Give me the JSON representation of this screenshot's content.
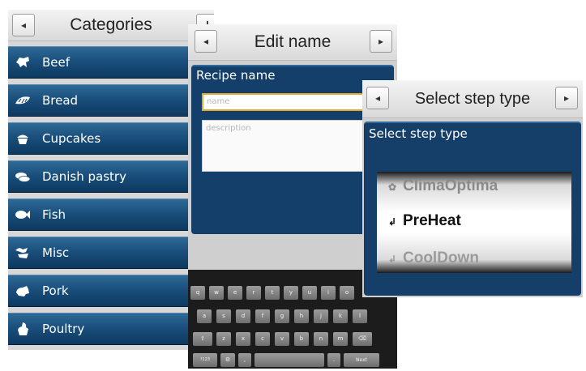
{
  "categories_screen": {
    "title": "Categories",
    "nav_left": "◂",
    "nav_right": "+",
    "items": [
      {
        "label": "Beef",
        "icon": "cow-icon"
      },
      {
        "label": "Bread",
        "icon": "bread-icon"
      },
      {
        "label": "Cupcakes",
        "icon": "cupcake-icon"
      },
      {
        "label": "Danish pastry",
        "icon": "pastry-icon"
      },
      {
        "label": "Fish",
        "icon": "fish-icon"
      },
      {
        "label": "Misc",
        "icon": "misc-icon"
      },
      {
        "label": "Pork",
        "icon": "pig-icon"
      },
      {
        "label": "Poultry",
        "icon": "chicken-icon"
      }
    ]
  },
  "edit_screen": {
    "title": "Edit name",
    "nav_left": "◂",
    "nav_right": "▸",
    "panel_title": "Recipe name",
    "name_placeholder": "name",
    "description_placeholder": "description",
    "keyboard": {
      "row1": [
        "q",
        "w",
        "e",
        "r",
        "t",
        "y",
        "u",
        "i",
        "o"
      ],
      "row2": [
        "a",
        "s",
        "d",
        "f",
        "g",
        "h",
        "j",
        "k",
        "l"
      ],
      "row3": [
        "⇧",
        "z",
        "x",
        "c",
        "v",
        "b",
        "n",
        "m",
        "⌫"
      ],
      "row4": [
        "?123",
        "⚙",
        ",",
        "",
        ".",
        "Next"
      ]
    }
  },
  "step_screen": {
    "title": "Select step type",
    "nav_left": "◂",
    "nav_right": "▸",
    "panel_title": "Select step type",
    "options": [
      {
        "label": "ClimaOptima",
        "selected": false
      },
      {
        "label": "PreHeat",
        "selected": true
      },
      {
        "label": "CoolDown",
        "selected": false
      }
    ]
  },
  "colors": {
    "row_blue": "#1a4f7c",
    "panel_blue": "#143f6a",
    "focus_orange": "#e8a531"
  }
}
